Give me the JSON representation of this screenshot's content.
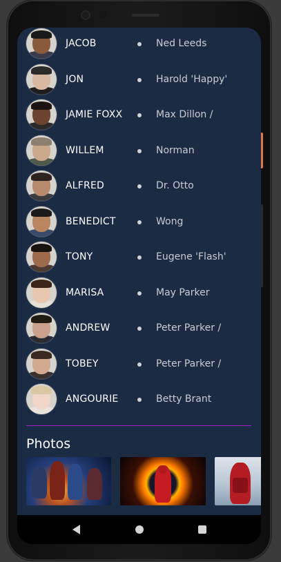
{
  "cast": [
    {
      "actor": "JACOB",
      "role": "Ned Leeds",
      "skin": "#8a5a3c",
      "hair": "#1a1a1a",
      "shirt": "#3a3a4a"
    },
    {
      "actor": "JON",
      "role": "Harold 'Happy'",
      "skin": "#d9b8a0",
      "hair": "#2b2b2b",
      "shirt": "#1e1e1e"
    },
    {
      "actor": "JAMIE FOXX",
      "role": "Max Dillon /",
      "skin": "#6b432e",
      "hair": "#1b1411",
      "shirt": "#2a2a2a"
    },
    {
      "actor": "WILLEM",
      "role": "Norman",
      "skin": "#c9a88b",
      "hair": "#8d8070",
      "shirt": "#4f5a4a"
    },
    {
      "actor": "ALFRED",
      "role": "Dr. Otto",
      "skin": "#b78a6d",
      "hair": "#2d2420",
      "shirt": "#3b3b3b"
    },
    {
      "actor": "BENEDICT",
      "role": "Wong",
      "skin": "#b8855f",
      "hair": "#1a1a1a",
      "shirt": "#3a4a6a"
    },
    {
      "actor": "TONY",
      "role": "Eugene 'Flash'",
      "skin": "#9d6a4c",
      "hair": "#1a1410",
      "shirt": "#4a3a30"
    },
    {
      "actor": "MARISA",
      "role": "May Parker",
      "skin": "#e8c8b0",
      "hair": "#3b2418",
      "shirt": "#e6e0d6"
    },
    {
      "actor": "ANDREW",
      "role": "Peter Parker /",
      "skin": "#c9a08a",
      "hair": "#241a14",
      "shirt": "#2b2b33"
    },
    {
      "actor": "TOBEY",
      "role": "Peter Parker /",
      "skin": "#d2aa90",
      "hair": "#3a2a20",
      "shirt": "#3a3030"
    },
    {
      "actor": "ANGOURIE",
      "role": "Betty Brant",
      "skin": "#efd6c6",
      "hair": "#d9c7a4",
      "shirt": "#e9e3dc"
    }
  ],
  "photos_section": {
    "title": "Photos"
  },
  "colors": {
    "background": "#1c2b44",
    "divider": "#a323c9",
    "text_primary": "#ffffff",
    "text_secondary": "#c9ccd2"
  },
  "icons": {
    "bullet": "bullet-dot-icon",
    "nav_back": "back-triangle-icon",
    "nav_home": "home-circle-icon",
    "nav_recents": "recents-square-icon"
  }
}
